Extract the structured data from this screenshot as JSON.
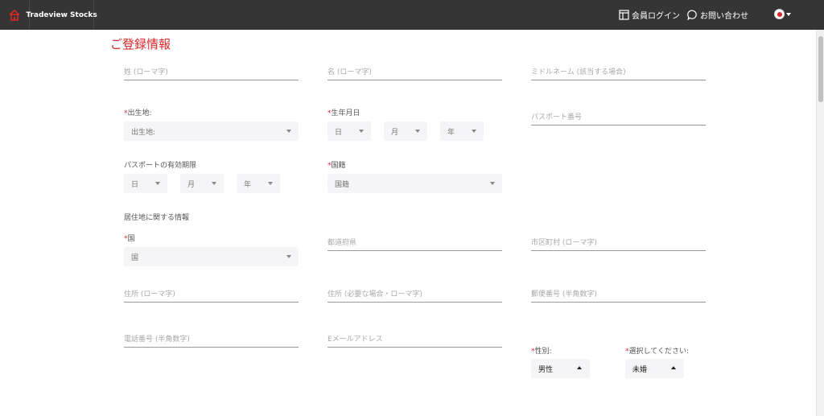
{
  "header": {
    "brand": "Tradeview Stocks",
    "login": "会員ログイン",
    "contact": "お問い合わせ",
    "accent": "#d62828"
  },
  "page": {
    "title": "ご登録情報"
  },
  "fields": {
    "last_name": "姓 (ローマ字)",
    "first_name": "名 (ローマ字)",
    "middle_name": "ミドルネーム (該当する場合)",
    "birthplace_label": "出生地:",
    "birthplace_select": "出生地:",
    "birthdate_label": "生年月日",
    "birth_day": "日",
    "birth_month": "月",
    "birth_year": "年",
    "passport_number": "パスポート番号",
    "passport_expiry_label": "パスポートの有効期限",
    "exp_day": "日",
    "exp_month": "月",
    "exp_year": "年",
    "nationality_label": "国籍",
    "nationality_select": "国籍",
    "residence_section": "居住地に関する情報",
    "country_label": "国",
    "country_select": "国",
    "prefecture": "都道府県",
    "city": "市区町村 (ローマ字)",
    "address1": "住所 (ローマ字)",
    "address2": "住所 (必要な場合・ローマ字)",
    "postal_code": "郵便番号 (半角数字)",
    "phone": "電話番号 (半角数字)",
    "email": "Eメールアドレス",
    "gender_label": "性別:",
    "gender_value": "男性",
    "marital_label": "選択してください:",
    "marital_value": "未婚"
  }
}
